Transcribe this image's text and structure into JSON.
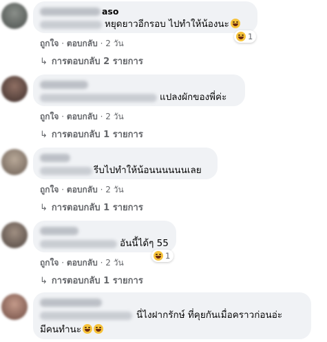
{
  "labels": {
    "like": "ถูกใจ",
    "reply": "ตอบกลับ",
    "sep": "·"
  },
  "comments": [
    {
      "name_tail": "aso",
      "text": "หยุดยาวอีกรอบ ไปทำให้น้องนะ",
      "emoji": [
        "grinning-squint-face"
      ],
      "time": "2 วัน",
      "reaction": {
        "icon": "laughing-face-icon",
        "count": "1"
      },
      "replies": "การตอบกลับ 2 รายการ"
    },
    {
      "name_tail": "",
      "text": "แปลงผักของพี่ค่ะ",
      "emoji": [],
      "time": "2 วัน",
      "reaction": null,
      "replies": "การตอบกลับ 1 รายการ"
    },
    {
      "name_tail": "",
      "text": "รีบไปทำให้น้อนนนนนนเลย",
      "emoji": [],
      "time": "2 วัน",
      "reaction": null,
      "replies": "การตอบกลับ 1 รายการ"
    },
    {
      "name_tail": "",
      "text": "อันนี้ได้ๆ 55",
      "emoji": [],
      "time": "2 วัน",
      "reaction": {
        "icon": "laughing-face-icon",
        "count": "1"
      },
      "replies": "การตอบกลับ 1 รายการ"
    },
    {
      "name_tail": "",
      "text": "นี่ไงฝากรักษ์ ที่คุยกันเมื่อคราวก่อนอ่ะ",
      "text2": "มีคนทำนะ",
      "emoji": [
        "laughing-face",
        "laughing-face"
      ],
      "time": "",
      "reaction": null,
      "replies": ""
    }
  ],
  "colors": {
    "bubble": "#f0f2f5",
    "meta_text": "#65676b",
    "emoji": "#f7c33b"
  }
}
